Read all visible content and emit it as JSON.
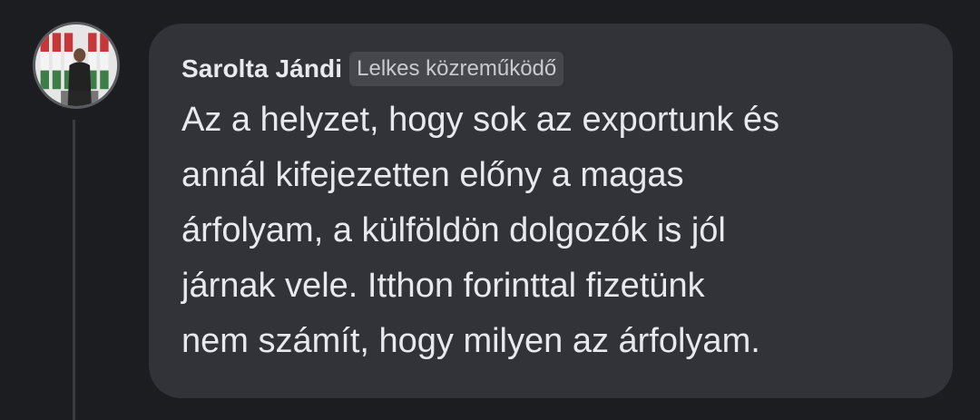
{
  "comment": {
    "author": "Sarolta Jándi",
    "badge": "Lelkes közreműködő",
    "text_lines": [
      "Az a helyzet, hogy sok az exportunk és",
      "annál kifejezetten előny a magas",
      "árfolyam, a külföldön dolgozók is jól",
      "járnak vele. Itthon forinttal fizetünk",
      "nem számít, hogy milyen az árfolyam."
    ]
  },
  "colors": {
    "background": "#1c1d21",
    "bubble": "#323338",
    "text": "#e8e9ed",
    "badge_bg": "#46474d",
    "thread_line": "#3a3b3f"
  }
}
